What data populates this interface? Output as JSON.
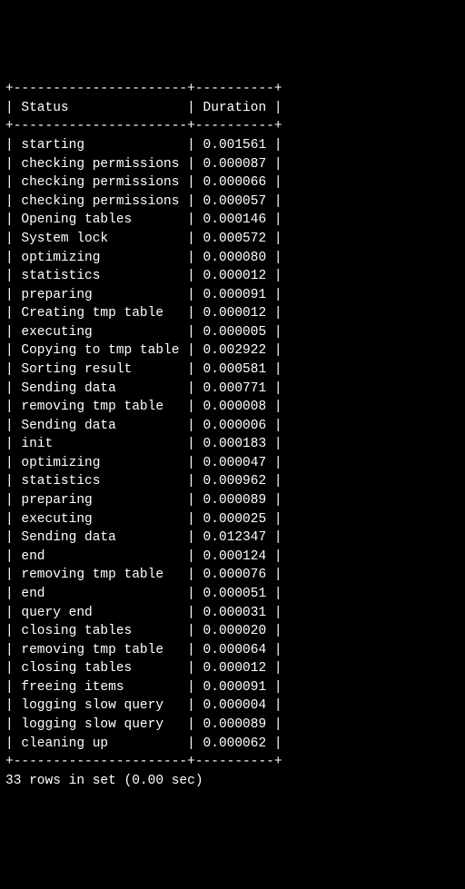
{
  "table": {
    "headers": {
      "status": "Status",
      "duration": "Duration"
    },
    "rows": [
      {
        "status": "starting",
        "duration": "0.001561"
      },
      {
        "status": "checking permissions",
        "duration": "0.000087"
      },
      {
        "status": "checking permissions",
        "duration": "0.000066"
      },
      {
        "status": "checking permissions",
        "duration": "0.000057"
      },
      {
        "status": "Opening tables",
        "duration": "0.000146"
      },
      {
        "status": "System lock",
        "duration": "0.000572"
      },
      {
        "status": "optimizing",
        "duration": "0.000080"
      },
      {
        "status": "statistics",
        "duration": "0.000012"
      },
      {
        "status": "preparing",
        "duration": "0.000091"
      },
      {
        "status": "Creating tmp table",
        "duration": "0.000012"
      },
      {
        "status": "executing",
        "duration": "0.000005"
      },
      {
        "status": "Copying to tmp table",
        "duration": "0.002922"
      },
      {
        "status": "Sorting result",
        "duration": "0.000581"
      },
      {
        "status": "Sending data",
        "duration": "0.000771"
      },
      {
        "status": "removing tmp table",
        "duration": "0.000008"
      },
      {
        "status": "Sending data",
        "duration": "0.000006"
      },
      {
        "status": "init",
        "duration": "0.000183"
      },
      {
        "status": "optimizing",
        "duration": "0.000047"
      },
      {
        "status": "statistics",
        "duration": "0.000962"
      },
      {
        "status": "preparing",
        "duration": "0.000089"
      },
      {
        "status": "executing",
        "duration": "0.000025"
      },
      {
        "status": "Sending data",
        "duration": "0.012347"
      },
      {
        "status": "end",
        "duration": "0.000124"
      },
      {
        "status": "removing tmp table",
        "duration": "0.000076"
      },
      {
        "status": "end",
        "duration": "0.000051"
      },
      {
        "status": "query end",
        "duration": "0.000031"
      },
      {
        "status": "closing tables",
        "duration": "0.000020"
      },
      {
        "status": "removing tmp table",
        "duration": "0.000064"
      },
      {
        "status": "closing tables",
        "duration": "0.000012"
      },
      {
        "status": "freeing items",
        "duration": "0.000091"
      },
      {
        "status": "logging slow query",
        "duration": "0.000004"
      },
      {
        "status": "logging slow query",
        "duration": "0.000089"
      },
      {
        "status": "cleaning up",
        "duration": "0.000062"
      }
    ],
    "footer": "33 rows in set (0.00 sec)"
  },
  "layout": {
    "status_width": 20,
    "duration_width": 8
  }
}
